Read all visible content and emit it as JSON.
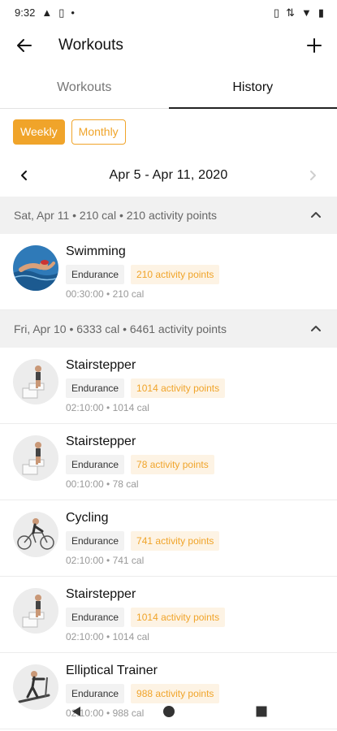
{
  "status": {
    "time": "9:32"
  },
  "app_bar": {
    "title": "Workouts"
  },
  "tabs": [
    {
      "label": "Workouts",
      "active": false
    },
    {
      "label": "History",
      "active": true
    }
  ],
  "period": {
    "weekly": "Weekly",
    "monthly": "Monthly",
    "selected": "Weekly"
  },
  "date_range": "Apr 5 - Apr 11, 2020",
  "days": [
    {
      "header": "Sat, Apr 11 • 210 cal • 210 activity points",
      "workouts": [
        {
          "name": "Swimming",
          "type": "Endurance",
          "points": "210 activity points",
          "meta": "00:30:00 • 210 cal",
          "icon": "swimming"
        }
      ]
    },
    {
      "header": "Fri, Apr 10 • 6333 cal • 6461 activity points",
      "workouts": [
        {
          "name": "Stairstepper",
          "type": "Endurance",
          "points": "1014 activity points",
          "meta": "02:10:00 • 1014 cal",
          "icon": "stairstepper"
        },
        {
          "name": "Stairstepper",
          "type": "Endurance",
          "points": "78 activity points",
          "meta": "00:10:00 • 78 cal",
          "icon": "stairstepper"
        },
        {
          "name": "Cycling",
          "type": "Endurance",
          "points": "741 activity points",
          "meta": "02:10:00 • 741 cal",
          "icon": "cycling"
        },
        {
          "name": "Stairstepper",
          "type": "Endurance",
          "points": "1014 activity points",
          "meta": "02:10:00 • 1014 cal",
          "icon": "stairstepper"
        },
        {
          "name": "Elliptical Trainer",
          "type": "Endurance",
          "points": "988 activity points",
          "meta": "02:10:00 • 988 cal",
          "icon": "elliptical"
        }
      ]
    }
  ],
  "colors": {
    "accent": "#f0a42a",
    "accent_bg": "#fdf3e4",
    "header_bg": "#f1f1f1"
  }
}
